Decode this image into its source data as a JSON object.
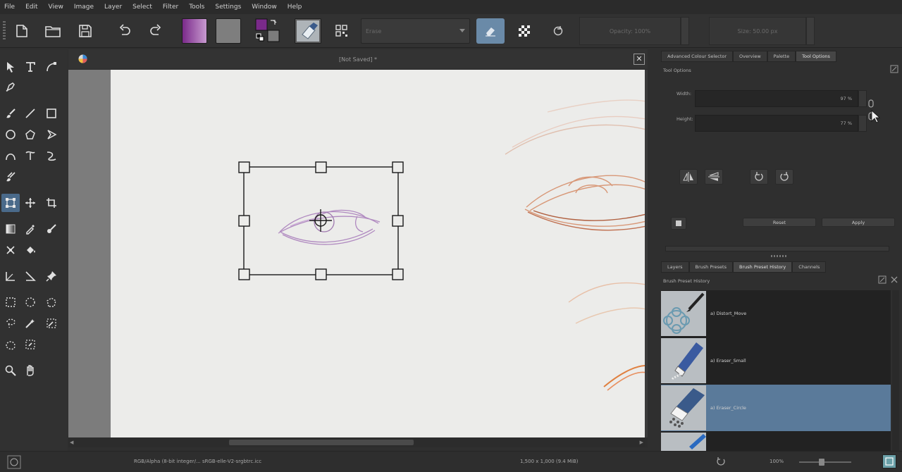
{
  "menu": [
    "File",
    "Edit",
    "View",
    "Image",
    "Layer",
    "Select",
    "Filter",
    "Tools",
    "Settings",
    "Window",
    "Help"
  ],
  "toolbar": {
    "brush_combo": "Erase",
    "opacity": "Opacity: 100%",
    "size": "Size: 50.00 px"
  },
  "document": {
    "title": "[Not Saved]  *",
    "close_glyph": "✕"
  },
  "dock": {
    "top_tabs": [
      "Advanced Colour Selector",
      "Overview",
      "Palette",
      "Tool Options"
    ],
    "tool_options_title": "Tool Options",
    "width_label": "Width:",
    "width_value": "97 %",
    "height_label": "Height:",
    "height_value": "77 %",
    "reset_label": "Reset",
    "apply_label": "Apply",
    "bottom_tabs": [
      "Layers",
      "Brush Presets",
      "Brush Preset History",
      "Channels"
    ],
    "history_title": "Brush Preset History",
    "presets": [
      {
        "name": "a) Distort_Move"
      },
      {
        "name": "a) Eraser_Small"
      },
      {
        "name": "a) Eraser_Circle"
      }
    ]
  },
  "status": {
    "color_space": "RGB/Alpha (8-bit integer/...  sRGB-elle-V2-srgbtrc.icc",
    "dimensions": "1,500 x 1,000 (9.4 MiB)",
    "zoom": "100%"
  },
  "colors": {
    "accent": "#4a6a8a",
    "selected_preset": "#5a7a9a",
    "foreground": "#7a2a8a",
    "background_swatch": "#7c7c7c"
  }
}
